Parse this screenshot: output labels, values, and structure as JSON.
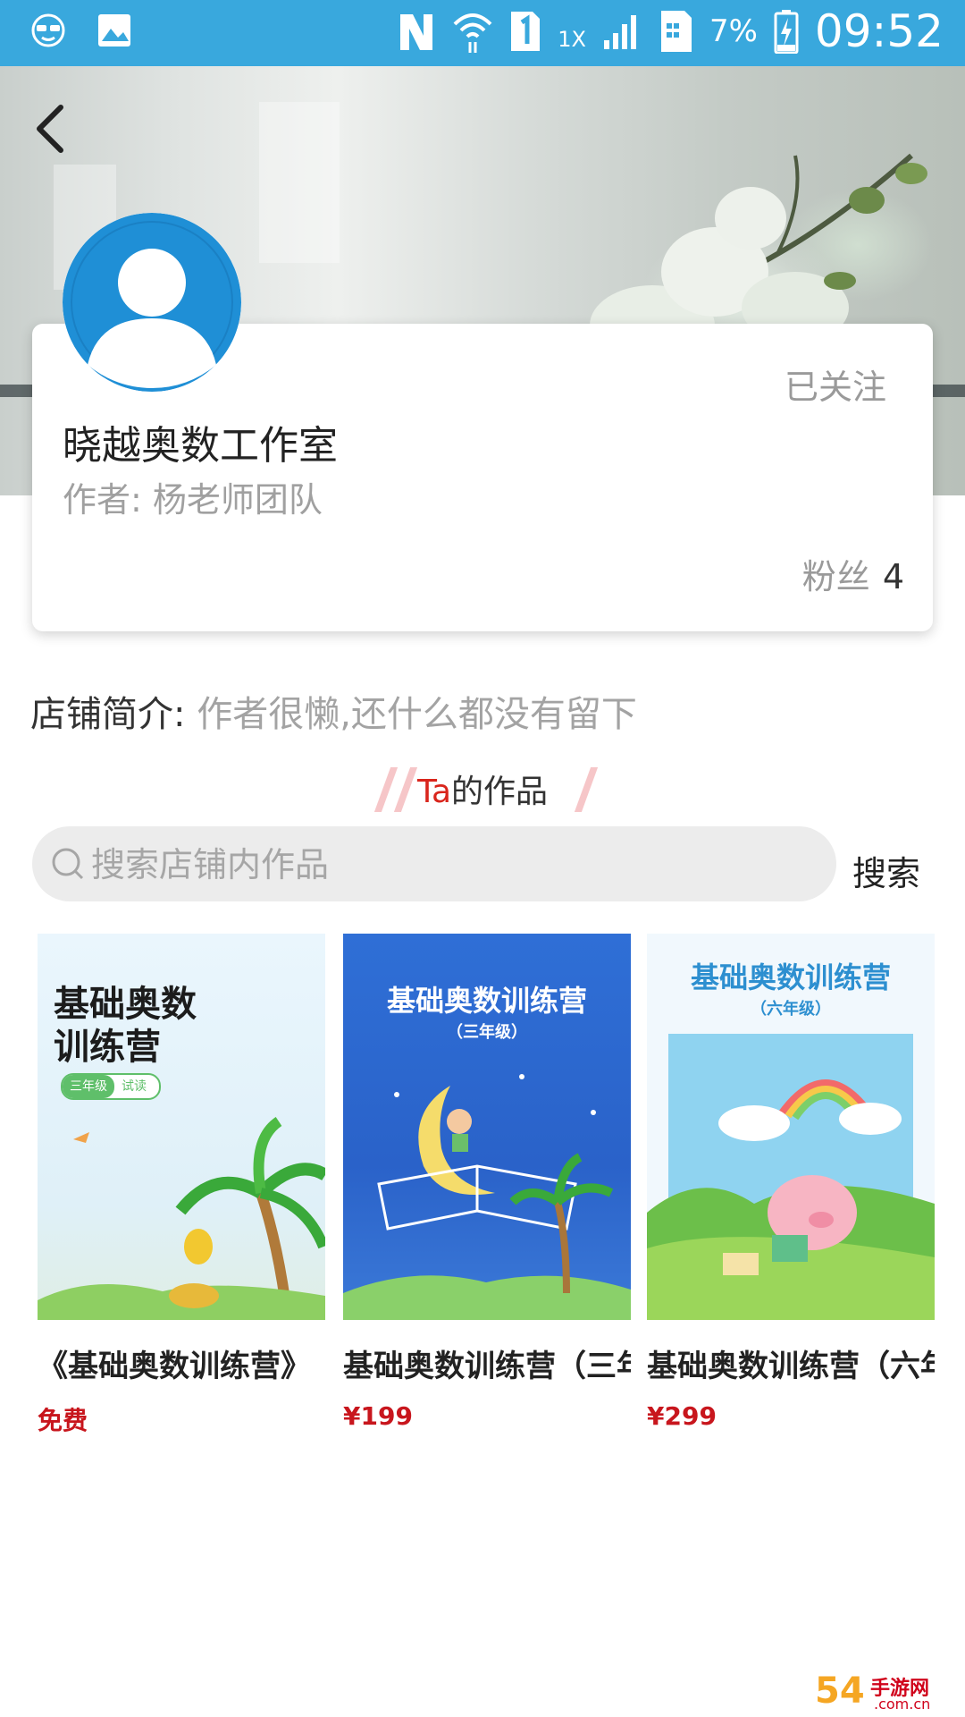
{
  "status_bar": {
    "battery_percent": "7%",
    "time": "09:52",
    "network": "1X"
  },
  "header": {
    "back_icon": "chevron-left-icon"
  },
  "shop": {
    "follow_status": "已关注",
    "name": "晓越奥数工作室",
    "author": "作者: 杨老师团队",
    "fans_label": "粉丝",
    "fans_count": "4",
    "intro_label": "店铺简介:",
    "intro_text": "作者很懒,还什么都没有留下"
  },
  "works": {
    "title_hl": "Ta",
    "title_rest": "的作品"
  },
  "search": {
    "placeholder": "搜索店铺内作品",
    "button_label": "搜索"
  },
  "products": [
    {
      "title": "《基础奥数训练营》",
      "price": "免费",
      "cover_title_1": "基础奥数",
      "cover_title_2": "训练营",
      "cover_tag_1": "三年级",
      "cover_tag_2": "试读"
    },
    {
      "title": "基础奥数训练营（三年级）",
      "price": "¥199",
      "cover_title": "基础奥数训练营",
      "cover_subtitle": "（三年级）"
    },
    {
      "title": "基础奥数训练营（六年级）",
      "price": "¥299",
      "cover_title": "基础奥数训练营",
      "cover_subtitle": "（六年级）"
    }
  ],
  "watermark": {
    "text_1": "54",
    "text_2": "手游网",
    "text_3": ".com.cn"
  },
  "colors": {
    "status_bar": "#39a8dd",
    "accent_red": "#c8161d",
    "avatar_blue": "#1f8fd6"
  }
}
